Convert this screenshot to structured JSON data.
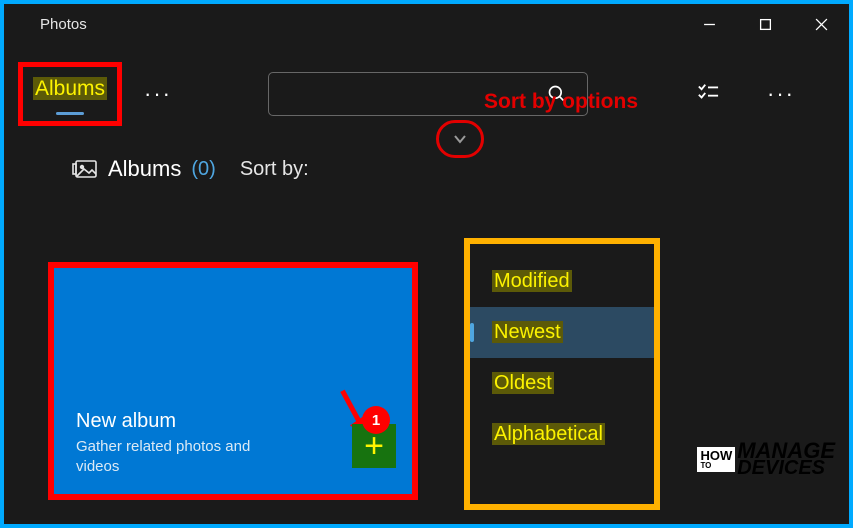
{
  "window": {
    "title": "Photos"
  },
  "toolbar": {
    "active_tab": "Albums",
    "more_glyph": "···",
    "search_placeholder": ""
  },
  "page": {
    "heading": "Albums",
    "count": "(0)",
    "sortby_label": "Sort by:"
  },
  "annotation": {
    "sort_label": "Sort by options",
    "badge": "1"
  },
  "card": {
    "title": "New album",
    "subtitle": "Gather related photos and videos",
    "add_glyph": "+"
  },
  "sort_options": [
    {
      "label": "Modified",
      "selected": false
    },
    {
      "label": "Newest",
      "selected": true
    },
    {
      "label": "Oldest",
      "selected": false
    },
    {
      "label": "Alphabetical",
      "selected": false
    }
  ],
  "logo": {
    "l1": "HOW",
    "l2": "TO",
    "l3": "MANAGE",
    "l4": "DEVICES"
  }
}
